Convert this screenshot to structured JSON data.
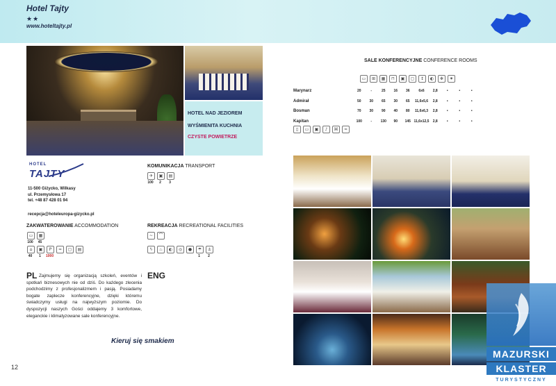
{
  "header": {
    "hotel_name": "Hotel Tajty",
    "stars": "★★",
    "website": "www.hoteltajty.pl"
  },
  "features": {
    "line1": "HOTEL NAD JEZIOREM",
    "line2": "WYŚMIENITA KUCHNIA",
    "line3": "CZYSTE POWIETRZE"
  },
  "logo": {
    "small": "HOTEL",
    "brand": "TAJTY"
  },
  "address": {
    "line1": "11-500 Giżycko, Wilkasy",
    "line2": "ul. Przemysłowa 17",
    "line3": "tel. +48 87 428 01 94",
    "email": "recepcja@hoteleuropa-gizycko.pl"
  },
  "transport": {
    "title_bold": "KOMUNIKACJA",
    "title_rest": "TRANSPORT",
    "icons": [
      "plane-icon",
      "train-icon",
      "bus-icon"
    ],
    "values": [
      "100",
      "2",
      "3"
    ]
  },
  "accommodation": {
    "title_bold": "ZAKWATEROWANIE",
    "title_rest": "ACCOMMODATION",
    "row1_values": [
      "100",
      "45"
    ],
    "row2_values": [
      "40",
      "1",
      "1000",
      "",
      "",
      ""
    ]
  },
  "recreation": {
    "title_bold": "REKREACJA",
    "title_rest": "RECREATIONAL FACILITIES",
    "values": [
      "",
      "",
      "",
      "",
      "",
      "1",
      "2"
    ]
  },
  "text": {
    "pl_head": "PL",
    "pl_body": "Zajmujemy się organizacją szkoleń, eventów i spotkań biznesowych nie od dziś. Do każdego zlecenia podchodzimy z profesjonalizmem i pasją. Posiadamy bogate zaplecze konferencyjne, dzięki któremu świadczymy usługi na najwyższym poziomie. Do dyspozycji naszych Gości oddajemy 3 komfortowe, eleganckie i klimatyzowane sale konferencyjne.",
    "eng_head": "ENG",
    "slogan": "Kieruj się smakiem"
  },
  "page_number": "12",
  "conference": {
    "title_bold": "SALE KONFERENCYJNE",
    "title_rest": "CONFERENCE ROOMS",
    "rows": [
      {
        "name": "Marynarz",
        "cells": [
          "20",
          "-",
          "25",
          "16",
          "36",
          "6x6",
          "2,8",
          "•",
          "•",
          "•"
        ]
      },
      {
        "name": "Admirał",
        "cells": [
          "50",
          "30",
          "65",
          "30",
          "65",
          "11,6x5,6",
          "2,8",
          "•",
          "•",
          "•"
        ]
      },
      {
        "name": "Bosman",
        "cells": [
          "70",
          "30",
          "90",
          "40",
          "80",
          "11,6x6,3",
          "2,8",
          "•",
          "•",
          "•"
        ]
      },
      {
        "name": "Kapitan",
        "cells": [
          "100",
          "-",
          "130",
          "90",
          "145",
          "11,6x12,5",
          "2,8",
          "•",
          "•",
          "•"
        ]
      }
    ]
  },
  "badge": {
    "line1": "MAZURSKI",
    "line2": "KLASTER",
    "line3": "TURYSTYCZNY"
  }
}
